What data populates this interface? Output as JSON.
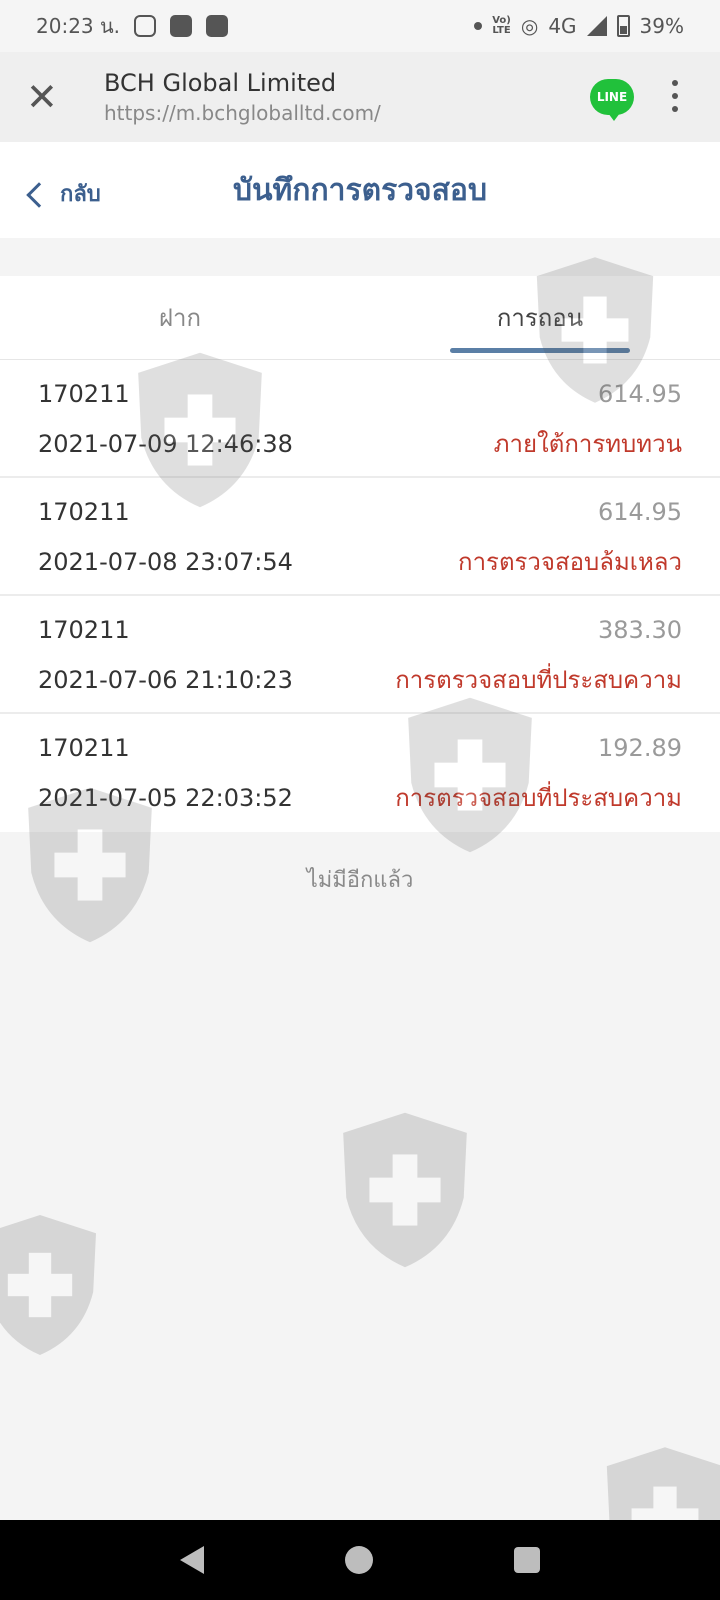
{
  "status_bar": {
    "time": "20:23 น.",
    "network": "4G",
    "battery": "39%",
    "volte_top": "Vo)",
    "volte_bottom": "LTE"
  },
  "browser": {
    "title": "BCH Global Limited",
    "url": "https://m.bchgloballtd.com/",
    "line_label": "LINE"
  },
  "header": {
    "back_label": "กลับ",
    "title": "บันทึกการตรวจสอบ"
  },
  "tabs": [
    {
      "label": "ฝาก",
      "active": false
    },
    {
      "label": "การถอน",
      "active": true
    }
  ],
  "records": [
    {
      "id": "170211",
      "amount": "614.95",
      "datetime": "2021-07-09 12:46:38",
      "status": "ภายใต้การทบทวน"
    },
    {
      "id": "170211",
      "amount": "614.95",
      "datetime": "2021-07-08 23:07:54",
      "status": "การตรวจสอบล้มเหลว"
    },
    {
      "id": "170211",
      "amount": "383.30",
      "datetime": "2021-07-06 21:10:23",
      "status": "การตรวจสอบที่ประสบความ"
    },
    {
      "id": "170211",
      "amount": "192.89",
      "datetime": "2021-07-05 22:03:52",
      "status": "การตรวจสอบที่ประสบความ"
    }
  ],
  "footer_text": "ไม่มีอีกแล้ว",
  "colors": {
    "accent": "#3c5f8e",
    "tab_indicator": "#5b7fa6",
    "status_red": "#c0392b",
    "line_green": "#21c13b"
  }
}
